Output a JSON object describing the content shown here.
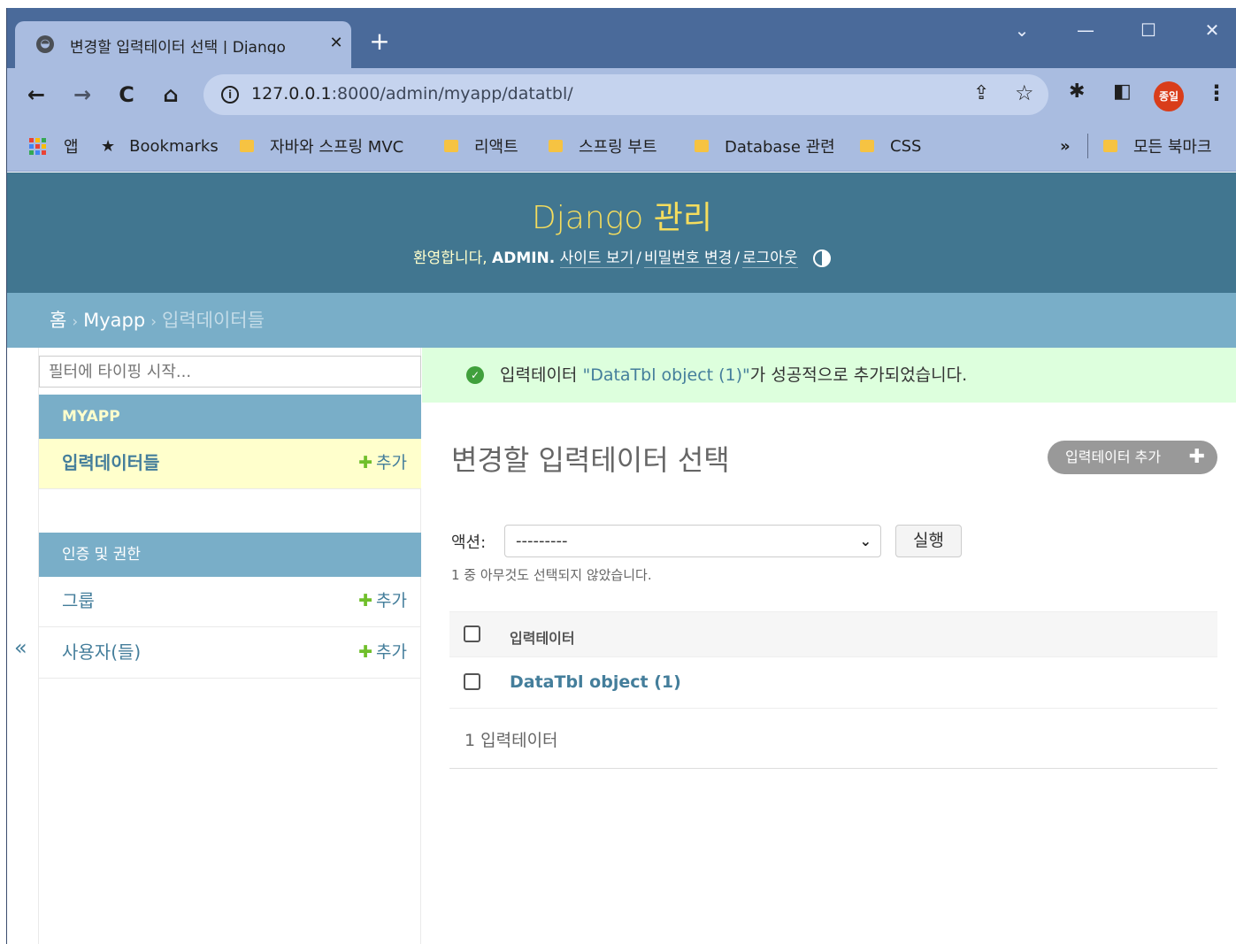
{
  "browser": {
    "tab_title": "변경할 입력테이터 선택 | Django",
    "tab_close": "✕",
    "new_tab": "+",
    "window_controls": [
      "⌄",
      "—",
      "☐",
      "✕"
    ],
    "url_host": "127.0.0.1",
    "url_rest": ":8000/admin/myapp/datatbl/",
    "profile_label": "종일",
    "bookmarks": [
      {
        "label": "앱",
        "icon": "apps-grid-icon"
      },
      {
        "label": "Bookmarks",
        "icon": "star-icon"
      },
      {
        "label": "자바와 스프링 MVC",
        "icon": "folder-icon"
      },
      {
        "label": "리액트",
        "icon": "folder-icon"
      },
      {
        "label": "스프링 부트",
        "icon": "folder-icon"
      },
      {
        "label": "Database 관련",
        "icon": "folder-icon"
      },
      {
        "label": "CSS",
        "icon": "folder-icon"
      }
    ],
    "bookmarks_overflow": "»",
    "all_bookmarks": "모든 북마크"
  },
  "header": {
    "branding": "Django 관리",
    "welcome": "환영합니다,",
    "username": "ADMIN.",
    "view_site": "사이트 보기",
    "change_password": "비밀번호 변경",
    "logout": "로그아웃",
    "separator": "/"
  },
  "breadcrumbs": {
    "home": "홈",
    "app": "Myapp",
    "current": "입력데이터들",
    "sep": "›"
  },
  "sidebar": {
    "filter_placeholder": "필터에 타이핑 시작...",
    "collapse_glyph": "«",
    "apps": [
      {
        "caption": "MYAPP",
        "models": [
          {
            "name": "입력데이터들",
            "add": "추가"
          }
        ]
      },
      {
        "caption": "인증 및 권한",
        "models": [
          {
            "name": "그룹",
            "add": "추가"
          },
          {
            "name": "사용자(들)",
            "add": "추가"
          }
        ]
      }
    ],
    "add_plus": "✚"
  },
  "message": {
    "prefix": "입력테이터",
    "object": "\"DataTbl object (1)\"",
    "suffix": "가 성공적으로 추가되었습니다."
  },
  "content": {
    "title": "변경할 입력테이터 선택",
    "add_button": "입력테이터 추가",
    "action_label": "액션:",
    "action_selected": "---------",
    "action_run": "실행",
    "action_counter": "1 중 아무것도 선택되지 않았습니다.",
    "column_header": "입력테이터",
    "rows": [
      "DataTbl object (1)"
    ],
    "paginator": "1 입력테이터"
  },
  "colors": {
    "header_bg": "#417690",
    "branding": "#f5dd5d",
    "breadcrumbs_bg": "#79aec8",
    "link": "#447e9b",
    "success_bg": "#ddffdd",
    "add_green": "#70bf2b"
  }
}
